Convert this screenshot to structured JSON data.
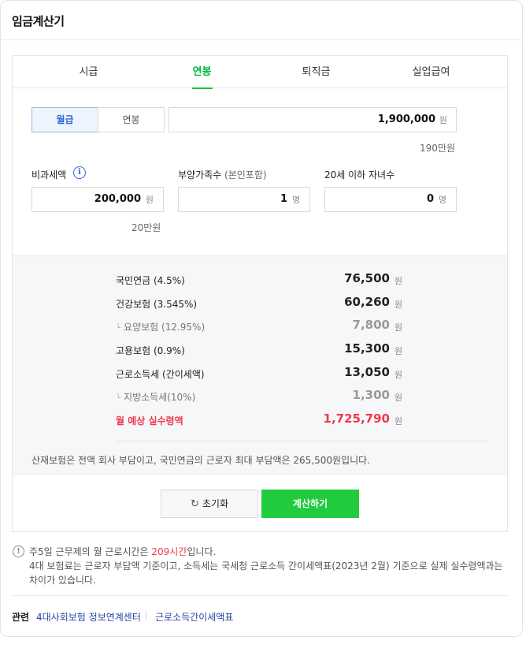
{
  "title": "임금계산기",
  "tabs": [
    {
      "label": "시급"
    },
    {
      "label": "연봉"
    },
    {
      "label": "퇴직금"
    },
    {
      "label": "실업급여"
    }
  ],
  "active_tab": "연봉",
  "pay_mode": {
    "options": [
      "월급",
      "연봉"
    ],
    "selected": "월급"
  },
  "salary": {
    "value": "1,900,000",
    "unit": "원",
    "hint": "190만원"
  },
  "nontax": {
    "label": "비과세액",
    "value": "200,000",
    "unit": "원",
    "hint": "20만원"
  },
  "dependents": {
    "label": "부양가족수",
    "sub": "(본인포함)",
    "value": "1",
    "unit": "명"
  },
  "children": {
    "label": "20세 이하 자녀수",
    "value": "0",
    "unit": "명"
  },
  "results": [
    {
      "label": "국민연금 (4.5%)",
      "value": "76,500",
      "unit": "원"
    },
    {
      "label": "건강보험 (3.545%)",
      "value": "60,260",
      "unit": "원"
    },
    {
      "label": "요양보험 (12.95%)",
      "value": "7,800",
      "unit": "원"
    },
    {
      "label": "고용보험 (0.9%)",
      "value": "15,300",
      "unit": "원"
    },
    {
      "label": "근로소득세 (간이세액)",
      "value": "13,050",
      "unit": "원"
    },
    {
      "label": "지방소득세(10%)",
      "value": "1,300",
      "unit": "원"
    },
    {
      "label": "월 예상 실수령액",
      "value": "1,725,790",
      "unit": "원"
    }
  ],
  "result_note": "산재보험은 전액 회사 부담이고, 국민연금의 근로자 최대 부담액은 265,500원입니다.",
  "buttons": {
    "reset": "초기화",
    "calculate": "계산하기"
  },
  "notice": {
    "line1_before": "주5일 근무제의 월 근로시간은 ",
    "line1_highlight": "209시간",
    "line1_after": "입니다.",
    "line2": "4대 보험료는 근로자 부담액 기준이고, 소득세는 국세청 근로소득 간이세액표(2023년 2월) 기준으로 실제 실수령액과는 차이가 있습니다."
  },
  "related": {
    "label": "관련",
    "links": [
      "4대사회보험 정보연계센터",
      "근로소득간이세액표"
    ]
  },
  "colors": {
    "accent_green": "#00c73c",
    "button_green": "#20cc3e",
    "highlight_red": "#ee3a4b",
    "link_blue": "#2846a8"
  },
  "icons": {
    "info": "info-icon",
    "reset": "refresh-icon",
    "notice": "exclamation-icon"
  }
}
